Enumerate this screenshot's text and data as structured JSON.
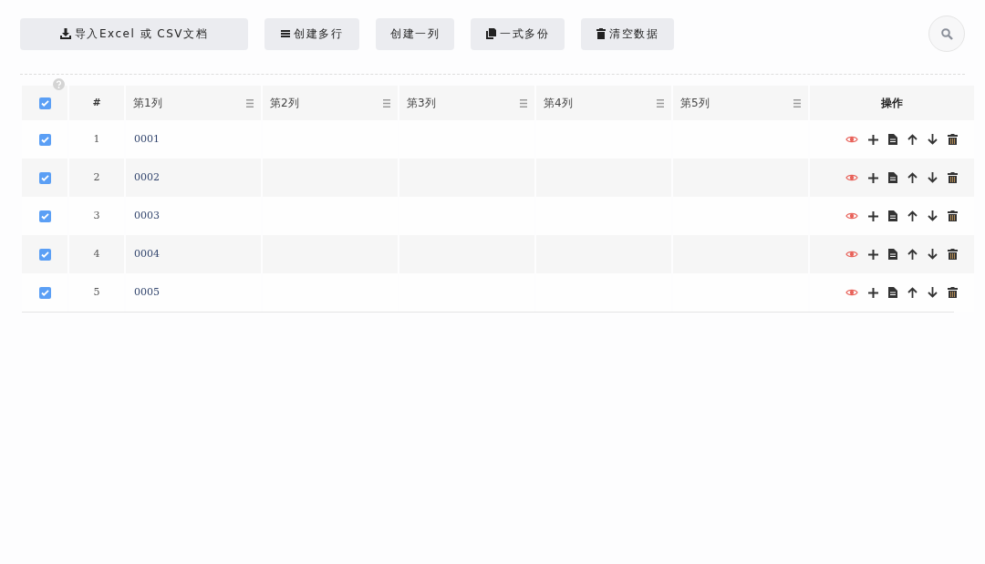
{
  "toolbar": [
    {
      "label": "导入Excel 或 CSV文档"
    },
    {
      "label": "创建多行"
    },
    {
      "label": "创建一列"
    },
    {
      "label": "一式多份"
    },
    {
      "label": "清空数据"
    }
  ],
  "table": {
    "select_all": {
      "checked": true
    },
    "index_header": "#",
    "columns": [
      "第1列",
      "第2列",
      "第3列",
      "第4列",
      "第5列"
    ],
    "actions_header": "操作",
    "rows": [
      {
        "checked": true,
        "index": "1",
        "cells": [
          "0001",
          "",
          "",
          "",
          ""
        ]
      },
      {
        "checked": true,
        "index": "2",
        "cells": [
          "0002",
          "",
          "",
          "",
          ""
        ]
      },
      {
        "checked": true,
        "index": "3",
        "cells": [
          "0003",
          "",
          "",
          "",
          ""
        ]
      },
      {
        "checked": true,
        "index": "4",
        "cells": [
          "0004",
          "",
          "",
          "",
          ""
        ]
      },
      {
        "checked": true,
        "index": "5",
        "cells": [
          "0005",
          "",
          "",
          "",
          ""
        ]
      }
    ]
  }
}
